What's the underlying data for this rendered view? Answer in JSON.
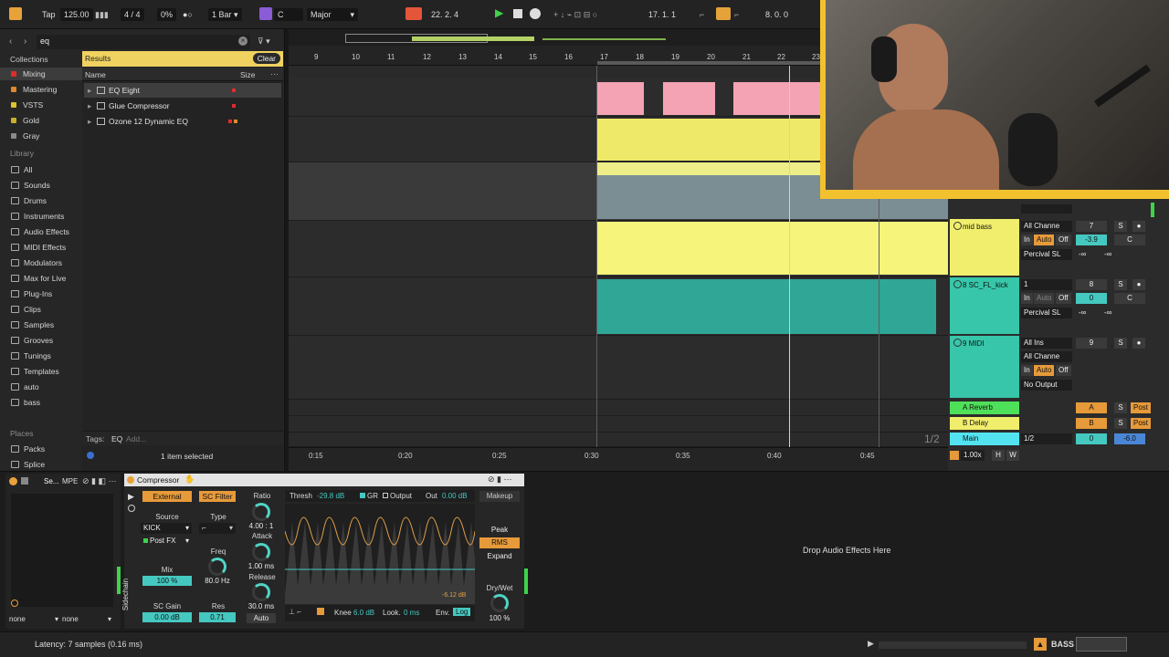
{
  "topbar": {
    "tap": "Tap",
    "tempo": "125.00",
    "signature": "4 / 4",
    "percent": "0%",
    "quant": "1 Bar",
    "key": "C",
    "scale": "Major",
    "position": "22.  2.  4",
    "loop_start": "17.  1.  1",
    "loop_len": "8.  0.  0"
  },
  "browser": {
    "search": "eq",
    "collections_title": "Collections",
    "collections": [
      {
        "label": "Mixing",
        "color": "#e02b2b"
      },
      {
        "label": "Mastering",
        "color": "#e0892b"
      },
      {
        "label": "VSTS",
        "color": "#e0c22b"
      },
      {
        "label": "Gold",
        "color": "#c8b02a"
      },
      {
        "label": "Gray",
        "color": "#8a8a8a"
      }
    ],
    "library_title": "Library",
    "library": [
      "All",
      "Sounds",
      "Drums",
      "Instruments",
      "Audio Effects",
      "MIDI Effects",
      "Modulators",
      "Max for Live",
      "Plug-Ins",
      "Clips",
      "Samples",
      "Grooves",
      "Tunings",
      "Templates",
      "auto",
      "bass"
    ],
    "places_title": "Places",
    "places": [
      "Packs",
      "Splice"
    ],
    "results_label": "Results",
    "clear_label": "Clear",
    "col_name": "Name",
    "col_size": "Size",
    "results": [
      {
        "name": "EQ Eight",
        "dots": [
          "#e02b2b"
        ]
      },
      {
        "name": "Glue Compressor",
        "dots": [
          "#e02b2b"
        ]
      },
      {
        "name": "Ozone 12 Dynamic EQ",
        "dots": [
          "#e02b2b",
          "#e0892b"
        ]
      }
    ],
    "tags_label": "Tags:",
    "tag_eq": "EQ",
    "tag_add": "Add...",
    "selected_info": "1 item selected"
  },
  "ruler": [
    "9",
    "10",
    "11",
    "12",
    "13",
    "14",
    "15",
    "16",
    "17",
    "18",
    "19",
    "20",
    "21",
    "22",
    "23"
  ],
  "timeline": [
    "0:15",
    "0:20",
    "0:25",
    "0:30",
    "0:35",
    "0:40",
    "0:45"
  ],
  "page_indicator": "1/2",
  "mixer": {
    "mid_bass": {
      "name": "mid bass",
      "input": "All Channe",
      "number": "7",
      "monitor_in": "In",
      "monitor_auto": "Auto",
      "monitor_off": "Off",
      "volume": "-3.9",
      "pan": "C",
      "output": "Percival SL",
      "sends": "-∞",
      "sends2": "-∞"
    },
    "kick": {
      "name": "8 SC_FL_kick",
      "input": "1",
      "number": "8",
      "monitor_in": "In",
      "monitor_auto": "Auto",
      "monitor_off": "Off",
      "volume": "0",
      "pan": "C",
      "output": "Percival SL",
      "sends": "-∞",
      "sends2": "-∞"
    },
    "midi": {
      "name": "9 MIDI",
      "input": "All Ins",
      "channel": "All Channe",
      "number": "9",
      "monitor_in": "In",
      "monitor_auto": "Auto",
      "monitor_off": "Off",
      "output": "No Output"
    },
    "returns": [
      {
        "name": "A Reverb",
        "letter": "A",
        "post": "Post"
      },
      {
        "name": "B Delay",
        "letter": "B",
        "post": "Post"
      }
    ],
    "main": {
      "name": "Main",
      "tempo_div": "1/2",
      "cue": "0",
      "volume": "-6.0"
    },
    "zoom": "1.00x",
    "h": "H",
    "w": "W",
    "solo": "S",
    "percival_partial": "Percival SL"
  },
  "device": {
    "se_title": "Se...",
    "mpe": "MPE",
    "none1": "none",
    "none2": "none",
    "comp_title": "Compressor",
    "external": "External",
    "sc_filter": "SC Filter",
    "source_label": "Source",
    "source_value": "KICK",
    "postfx": "Post FX",
    "type_label": "Type",
    "mix_label": "Mix",
    "mix_value": "100 %",
    "freq_label": "Freq",
    "freq_value": "80.0 Hz",
    "scgain_label": "SC Gain",
    "scgain_value": "0.00 dB",
    "res_label": "Res",
    "res_value": "0.71",
    "ratio_label": "Ratio",
    "ratio_value": "4.00 : 1",
    "attack_label": "Attack",
    "attack_value": "1.00 ms",
    "release_label": "Release",
    "release_value": "30.0 ms",
    "auto_label": "Auto",
    "thresh_label": "Thresh",
    "thresh_value": "-29.8 dB",
    "gr_label": "GR",
    "output_label": "Output",
    "out_label": "Out",
    "out_value": "0.00 dB",
    "makeup": "Makeup",
    "peak": "Peak",
    "rms": "RMS",
    "expand": "Expand",
    "drywet_label": "Dry/Wet",
    "drywet_value": "100 %",
    "knee_label": "Knee",
    "knee_value": "6.0 dB",
    "look_label": "Look.",
    "look_value": "0 ms",
    "env_label": "Env.",
    "env_value": "Log",
    "gr_readout": "-6.12 dB",
    "sidechain": "Sidechain",
    "drop_hint": "Drop Audio Effects Here"
  },
  "status": {
    "latency": "Latency: 7 samples (0.16 ms)",
    "bass_label": "BASS"
  }
}
